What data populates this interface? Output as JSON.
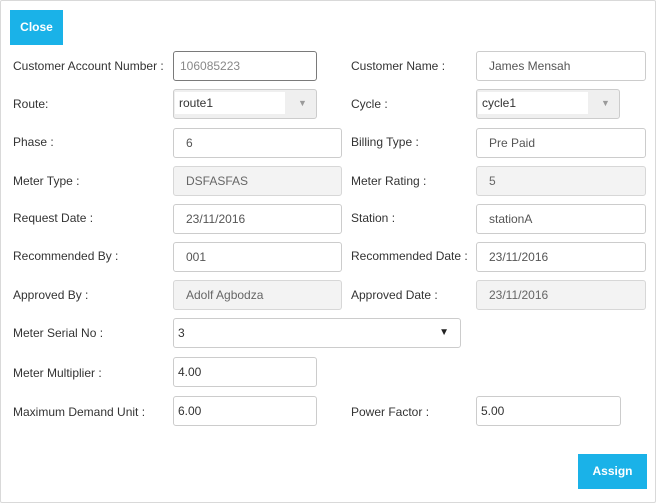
{
  "buttons": {
    "close": "Close",
    "assign": "Assign"
  },
  "fields": {
    "customer_account_number": {
      "label": "Customer Account Number :",
      "value": "106085223"
    },
    "customer_name": {
      "label": "Customer Name :",
      "value": "James Mensah"
    },
    "route": {
      "label": "Route:",
      "value": "route1"
    },
    "cycle": {
      "label": "Cycle :",
      "value": "cycle1"
    },
    "phase": {
      "label": "Phase :",
      "value": "6"
    },
    "billing_type": {
      "label": "Billing Type :",
      "value": "Pre Paid"
    },
    "meter_type": {
      "label": "Meter Type :",
      "value": "DSFASFAS"
    },
    "meter_rating": {
      "label": "Meter Rating :",
      "value": "5"
    },
    "request_date": {
      "label": "Request Date :",
      "value": "23/11/2016"
    },
    "station": {
      "label": "Station :",
      "value": "stationA"
    },
    "recommended_by": {
      "label": "Recommended By :",
      "value": "001"
    },
    "recommended_date": {
      "label": "Recommended Date :",
      "value": "23/11/2016"
    },
    "approved_by": {
      "label": "Approved By :",
      "value": "Adolf Agbodza"
    },
    "approved_date": {
      "label": "Approved Date :",
      "value": "23/11/2016"
    },
    "meter_serial_no": {
      "label": "Meter Serial No :",
      "value": "3"
    },
    "meter_multiplier": {
      "label": "Meter Multiplier :",
      "value": "4.00"
    },
    "maximum_demand_unit": {
      "label": "Maximum Demand Unit :",
      "value": "6.00"
    },
    "power_factor": {
      "label": "Power Factor :",
      "value": "5.00"
    }
  },
  "icons": {
    "select_arrow": "caret-down-icon"
  }
}
